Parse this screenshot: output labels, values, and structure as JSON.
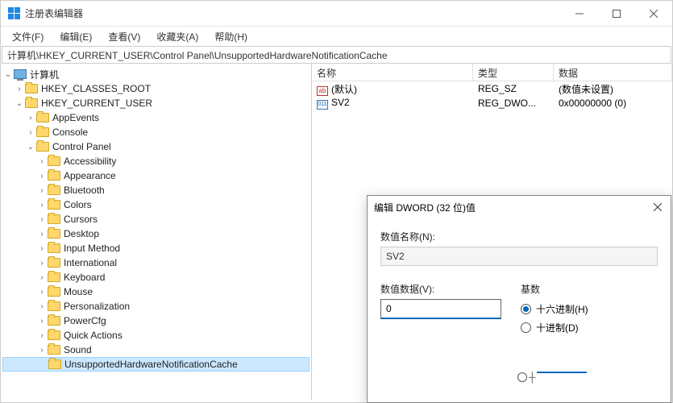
{
  "window": {
    "title": "注册表编辑器"
  },
  "menu": {
    "file": "文件(F)",
    "edit": "编辑(E)",
    "view": "查看(V)",
    "favorites": "收藏夹(A)",
    "help": "帮助(H)"
  },
  "path": "计算机\\HKEY_CURRENT_USER\\Control Panel\\UnsupportedHardwareNotificationCache",
  "tree": {
    "root": "计算机",
    "hkcr": "HKEY_CLASSES_ROOT",
    "hkcu": "HKEY_CURRENT_USER",
    "items": [
      "AppEvents",
      "Console",
      "Control Panel",
      "Accessibility",
      "Appearance",
      "Bluetooth",
      "Colors",
      "Cursors",
      "Desktop",
      "Input Method",
      "International",
      "Keyboard",
      "Mouse",
      "Personalization",
      "PowerCfg",
      "Quick Actions",
      "Sound",
      "UnsupportedHardwareNotificationCache"
    ]
  },
  "list": {
    "cols": {
      "name": "名称",
      "type": "类型",
      "data": "数据"
    },
    "rows": [
      {
        "icon": "ab",
        "name": "(默认)",
        "type": "REG_SZ",
        "data": "(数值未设置)"
      },
      {
        "icon": "bin",
        "name": "SV2",
        "type": "REG_DWO...",
        "data": "0x00000000 (0)"
      }
    ]
  },
  "dialog": {
    "title": "编辑 DWORD (32 位)值",
    "name_label": "数值名称(N):",
    "name_value": "SV2",
    "data_label": "数值数据(V):",
    "data_value": "0",
    "radix_label": "基数",
    "radix_hex": "十六进制(H)",
    "radix_dec": "十进制(D)"
  }
}
